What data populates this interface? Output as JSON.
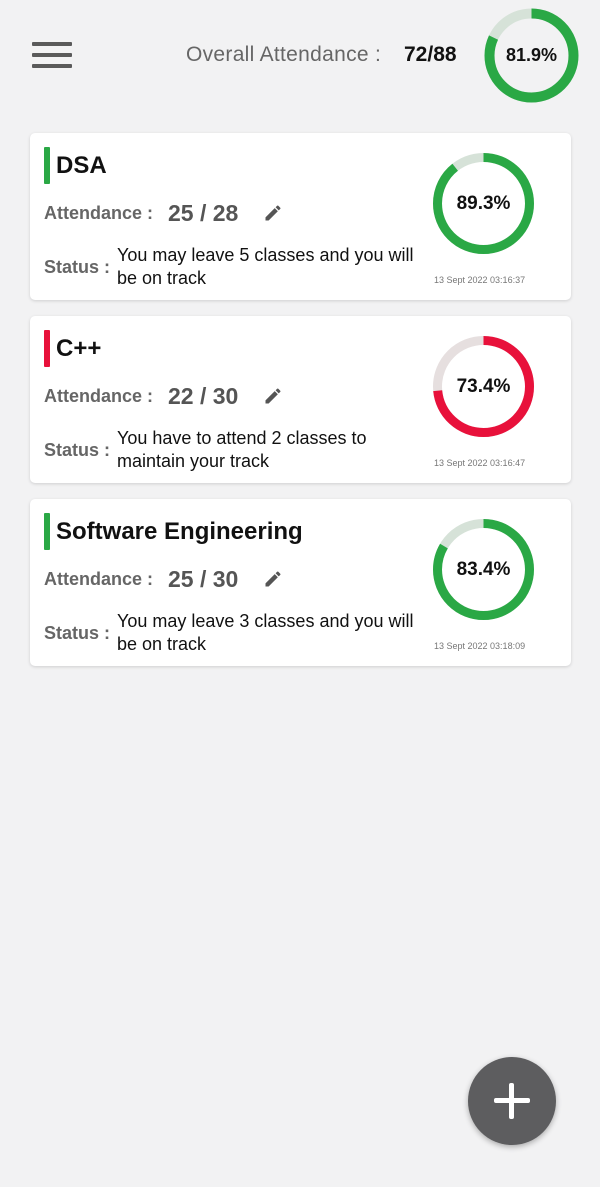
{
  "header": {
    "menu_icon": "hamburger-menu-icon",
    "overall_label": "Overall Attendance :",
    "overall_value": "72/88",
    "overall_percent_label": "81.9%",
    "overall_percent": 81.9,
    "overall_color": "#2aa845"
  },
  "subjects": [
    {
      "name": "DSA",
      "attendance_label": "Attendance :",
      "attendance_value": "25 / 28",
      "status_label": "Status :",
      "status_text": "You may leave 5 classes and you will be on track",
      "percent_label": "89.3%",
      "percent": 89.3,
      "color": "#2aa845",
      "timestamp": "13 Sept 2022 03:16:37"
    },
    {
      "name": "C++",
      "attendance_label": "Attendance :",
      "attendance_value": "22 / 30",
      "status_label": "Status :",
      "status_text": "You have to attend 2 classes to maintain your track",
      "percent_label": "73.4%",
      "percent": 73.4,
      "color": "#e8113b",
      "timestamp": "13 Sept 2022 03:16:47"
    },
    {
      "name": "Software Engineering",
      "attendance_label": "Attendance :",
      "attendance_value": "25 / 30",
      "status_label": "Status :",
      "status_text": "You may leave 3 classes and you will be on track",
      "percent_label": "83.4%",
      "percent": 83.4,
      "color": "#2aa845",
      "timestamp": "13 Sept 2022 03:18:09"
    }
  ],
  "colors": {
    "ring_track_green": "#d6e2d8",
    "ring_track_red": "#e6dfdf"
  },
  "fab": {
    "icon": "plus-icon"
  }
}
